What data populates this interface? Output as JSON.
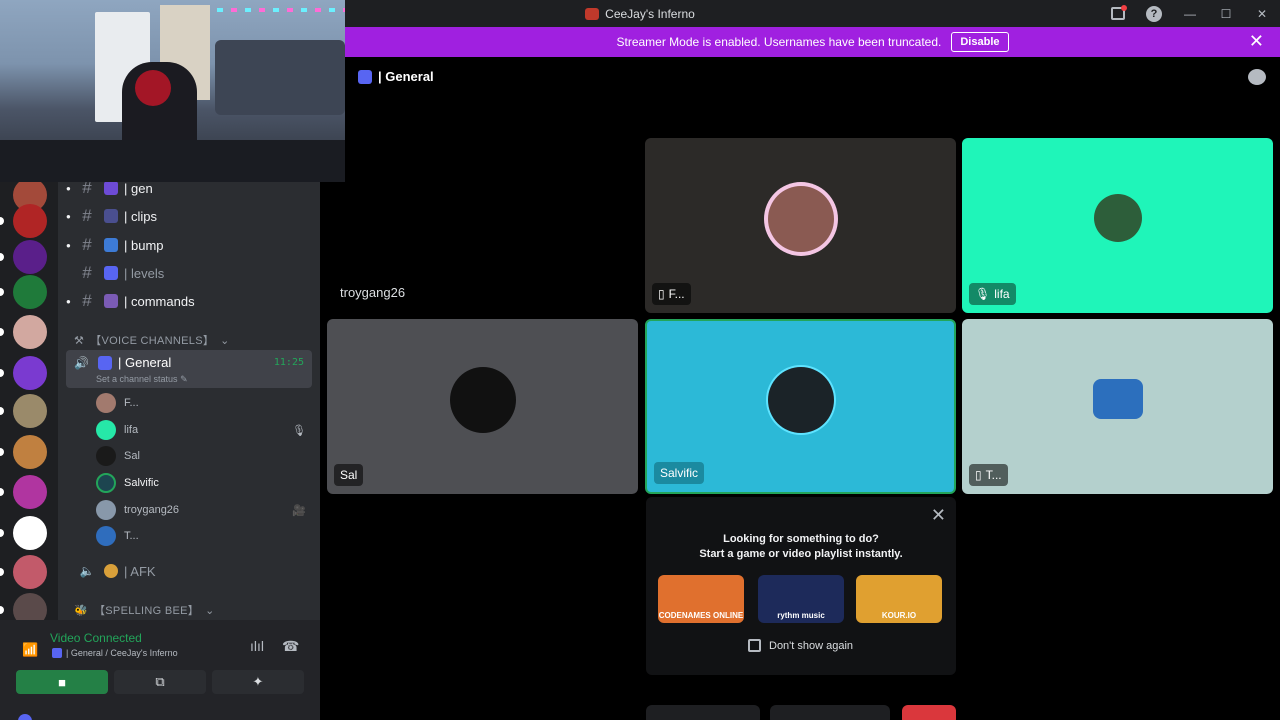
{
  "window": {
    "title": "CeeJay's Inferno"
  },
  "banner": {
    "text": "Streamer Mode is enabled. Usernames have been truncated.",
    "button": "Disable"
  },
  "channels": {
    "text": [
      {
        "name": "| gen",
        "muted": false,
        "emoji_color": "#6d4bd6"
      },
      {
        "name": "| clips",
        "muted": false,
        "emoji_color": "#4a4f8f"
      },
      {
        "name": "| bump",
        "muted": false,
        "emoji_color": "#3d7bd6"
      },
      {
        "name": "| levels",
        "muted": true,
        "emoji_color": "#5865f2"
      },
      {
        "name": "| commands",
        "muted": false,
        "emoji_color": "#7b5bb5"
      }
    ],
    "voice_category": "【VOICE CHANNELS】",
    "active_voice": {
      "name": "| General",
      "time": "11:25",
      "status": "Set a channel status"
    },
    "members": [
      {
        "name": "F...",
        "bold": false,
        "color": "#a27a6e",
        "icon": ""
      },
      {
        "name": "lifa",
        "bold": false,
        "color": "#26e8a8",
        "icon": "🎙"
      },
      {
        "name": "Sal",
        "bold": false,
        "color": "#1a1a1a",
        "icon": ""
      },
      {
        "name": "Salvific",
        "bold": true,
        "color": "#1d4550",
        "icon": ""
      },
      {
        "name": "troygang26",
        "bold": false,
        "color": "#8898aa",
        "icon": "🎥"
      },
      {
        "name": "T...",
        "bold": false,
        "color": "#2f6dbd",
        "icon": ""
      }
    ],
    "afk": "| AFK",
    "spelling_category": "【SPELLING BEE】"
  },
  "voice_panel": {
    "label": "Video Connected",
    "sub": "| General / CeeJay's Inferno"
  },
  "main": {
    "channel": "| General",
    "tiles": [
      {
        "name": "F...",
        "bg": "#2c2a28",
        "avatar": "#8a5a52",
        "icon": "📱"
      },
      {
        "name": "lifa",
        "bg": "#1ff5b9",
        "avatar": "#2d5e3a",
        "icon": "🎙"
      },
      {
        "name": "Sal",
        "bg": "#4e4f53",
        "avatar": "#111111",
        "icon": ""
      },
      {
        "name": "Salvific",
        "bg": "#2cb9d7",
        "avatar": "#1b2328",
        "icon": ""
      },
      {
        "name": "T...",
        "bg": "#b4d0cd",
        "avatar": "#2c6fbd",
        "icon": "📱"
      }
    ],
    "no_video_user": "troygang26",
    "activity": {
      "line1": "Looking for something to do?",
      "line2": "Start a game or video playlist instantly.",
      "games": [
        {
          "label": "CODENAMES ONLINE",
          "color": "#e0702e"
        },
        {
          "label": "rythm music",
          "color": "#1d2a5a"
        },
        {
          "label": "KOUR.IO",
          "color": "#e0a030"
        }
      ],
      "checkbox": "Don't show again"
    }
  },
  "rail_servers": [
    "#a34a3a",
    "#b02525",
    "#5a1f8a",
    "#1f7a3a",
    "#d2a8a0",
    "#7a3ad0",
    "#9a8a6a",
    "#c08040",
    "#b035a0",
    "#ffffff",
    "#c25a6a",
    "#5a4a4a"
  ]
}
